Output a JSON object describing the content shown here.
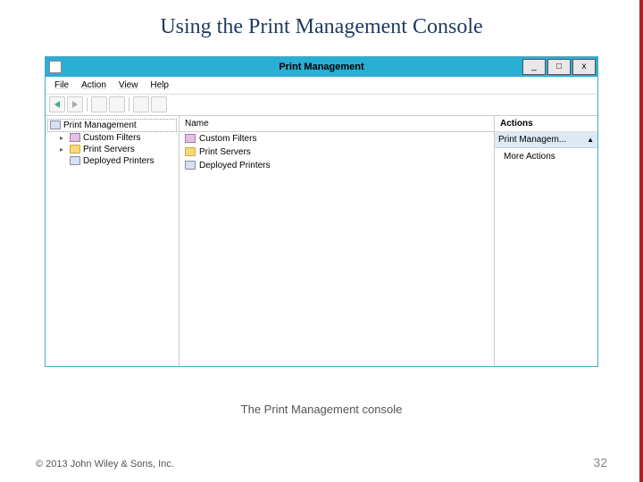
{
  "slide": {
    "title": "Using the Print Management Console",
    "caption": "The Print Management console",
    "copyright": "© 2013 John Wiley & Sons, Inc.",
    "page_number": "32"
  },
  "window": {
    "title": "Print Management",
    "controls": {
      "minimize": "_",
      "maximize": "□",
      "close": "x"
    },
    "menubar": [
      "File",
      "Action",
      "View",
      "Help"
    ],
    "tree": {
      "root": "Print Management",
      "items": [
        {
          "label": "Custom Filters",
          "icon": "filter",
          "expandable": true
        },
        {
          "label": "Print Servers",
          "icon": "folder",
          "expandable": true
        },
        {
          "label": "Deployed Printers",
          "icon": "printer",
          "expandable": false
        }
      ]
    },
    "list": {
      "header": "Name",
      "items": [
        {
          "label": "Custom Filters",
          "icon": "filter"
        },
        {
          "label": "Print Servers",
          "icon": "folder"
        },
        {
          "label": "Deployed Printers",
          "icon": "printer"
        }
      ]
    },
    "actions": {
      "header": "Actions",
      "group": "Print Managem...",
      "caret": "▲",
      "items": [
        "More Actions"
      ]
    }
  }
}
